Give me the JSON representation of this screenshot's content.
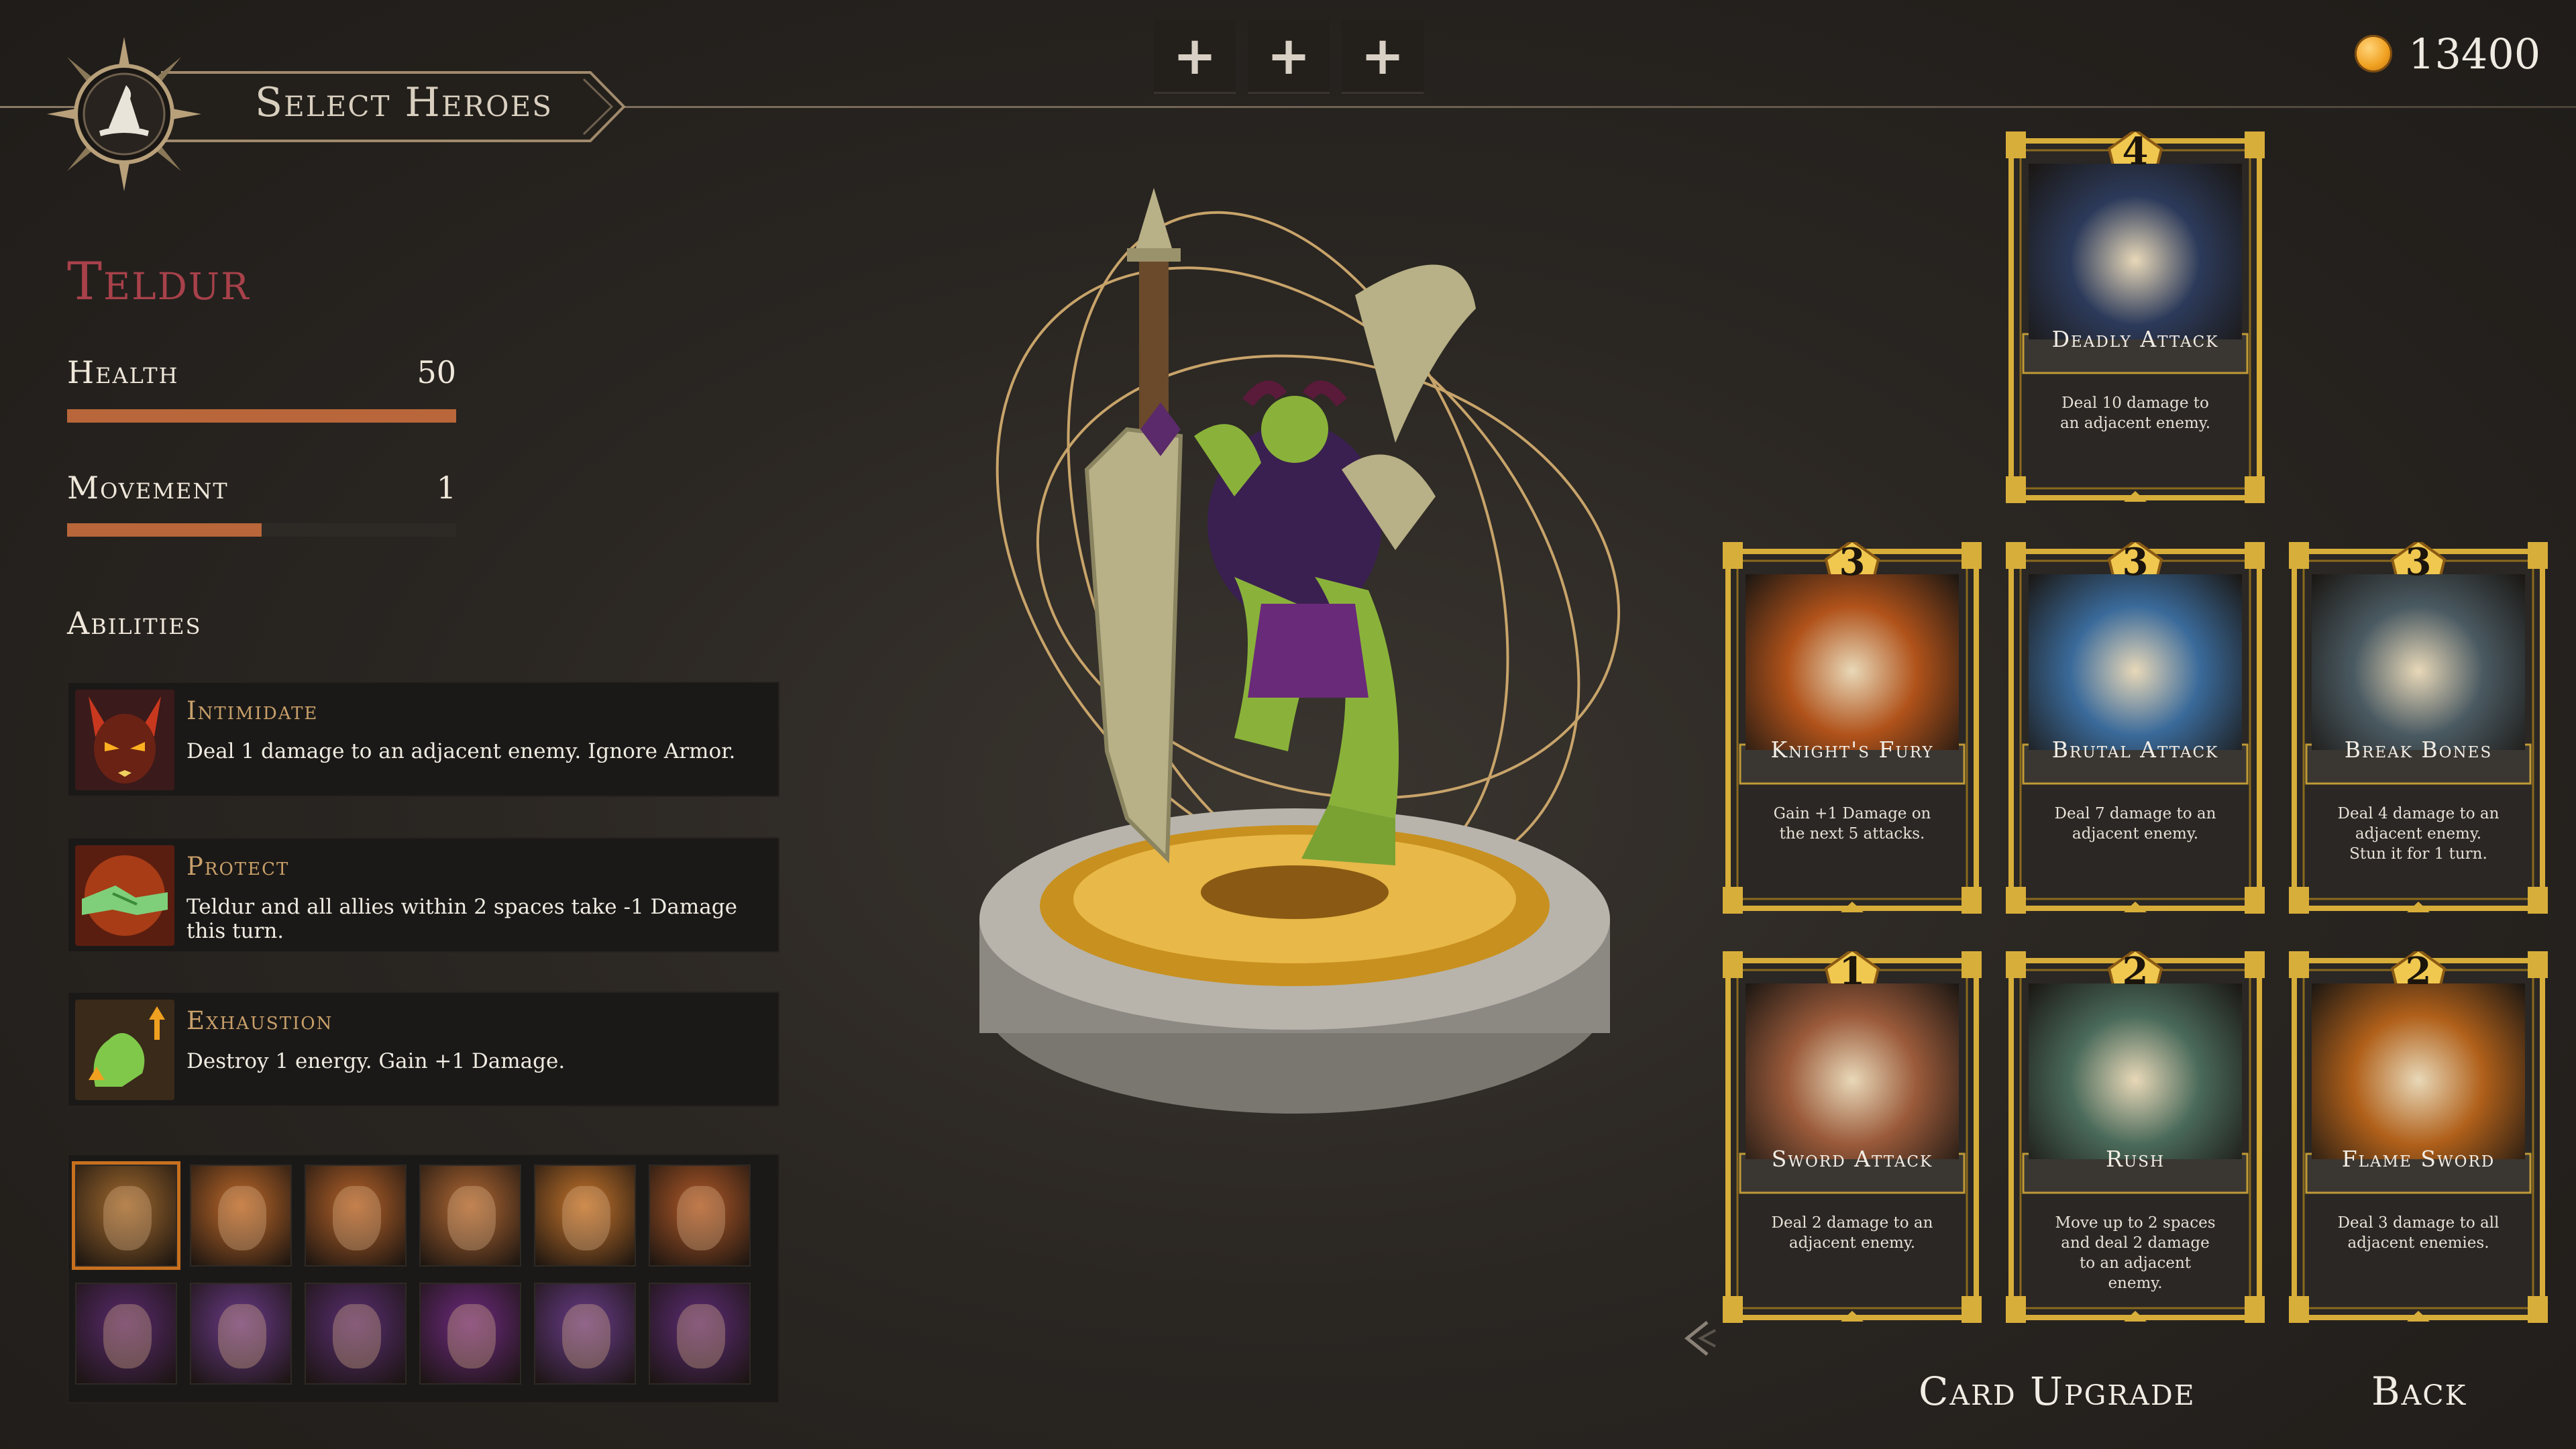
{
  "header": {
    "title": "Select Heroes",
    "emblem_icon": "wizard-hat-icon",
    "plus_buttons": [
      "+",
      "+",
      "+"
    ],
    "currency_icon": "gold-coin-icon",
    "currency_value": "13400"
  },
  "hero": {
    "name": "Teldur",
    "stats": [
      {
        "label": "Health",
        "value": "50",
        "fill": 1.0
      },
      {
        "label": "Movement",
        "value": "1",
        "fill": 0.5
      }
    ],
    "abilities_title": "Abilities",
    "abilities": [
      {
        "name": "Intimidate",
        "icon": "demon-face-icon",
        "desc": "Deal 1 damage to an adjacent enemy. Ignore Armor."
      },
      {
        "name": "Protect",
        "icon": "handshake-icon",
        "desc": "Teldur and all allies within 2 spaces take -1 Damage this turn."
      },
      {
        "name": "Exhaustion",
        "icon": "flexed-arm-icon",
        "desc": "Destroy 1 energy. Gain +1 Damage."
      }
    ]
  },
  "roster": {
    "portraits": [
      {
        "name": "portrait-lizardman",
        "color": "#a26a2e",
        "selected": true
      },
      {
        "name": "portrait-mohawk-orc",
        "color": "#c06a2a"
      },
      {
        "name": "portrait-bald-warrior",
        "color": "#b8642a"
      },
      {
        "name": "portrait-masked-elf",
        "color": "#b46a34"
      },
      {
        "name": "portrait-dwarf",
        "color": "#c8762c"
      },
      {
        "name": "portrait-hooded-rogue",
        "color": "#b25a28"
      },
      {
        "name": "portrait-red-witch",
        "color": "#5a2a6e"
      },
      {
        "name": "portrait-werewolf",
        "color": "#6a3a88"
      },
      {
        "name": "portrait-monk",
        "color": "#5a2e72"
      },
      {
        "name": "portrait-horned-sorceress",
        "color": "#6e2a80"
      },
      {
        "name": "portrait-white-hair-elf",
        "color": "#6a3c8a"
      },
      {
        "name": "portrait-warrior-woman",
        "color": "#5e2c76"
      }
    ]
  },
  "cards": [
    {
      "cost": "4",
      "name": "Deadly Attack",
      "desc": "Deal 10 damage to an adjacent enemy.",
      "art": "#2c3a5a"
    },
    {
      "cost": "3",
      "name": "Knight's Fury",
      "desc": "Gain +1 Damage on the next 5 attacks.",
      "art": "#b0521a"
    },
    {
      "cost": "3",
      "name": "Brutal Attack",
      "desc": "Deal 7 damage to an adjacent enemy.",
      "art": "#3a6a9a"
    },
    {
      "cost": "3",
      "name": "Break Bones",
      "desc": "Deal 4 damage to an adjacent enemy. Stun it for 1 turn.",
      "art": "#4a5a62"
    },
    {
      "cost": "1",
      "name": "Sword Attack",
      "desc": "Deal 2 damage to an adjacent enemy.",
      "art": "#9a5a3a"
    },
    {
      "cost": "2",
      "name": "Rush",
      "desc": "Move up to 2 spaces and deal 2 damage to an adjacent enemy.",
      "art": "#4a6a5a"
    },
    {
      "cost": "2",
      "name": "Flame Sword",
      "desc": "Deal 3 damage to all adjacent enemies.",
      "art": "#b0601a"
    }
  ],
  "footer": {
    "card_upgrade": "Card Upgrade",
    "back": "Back"
  }
}
